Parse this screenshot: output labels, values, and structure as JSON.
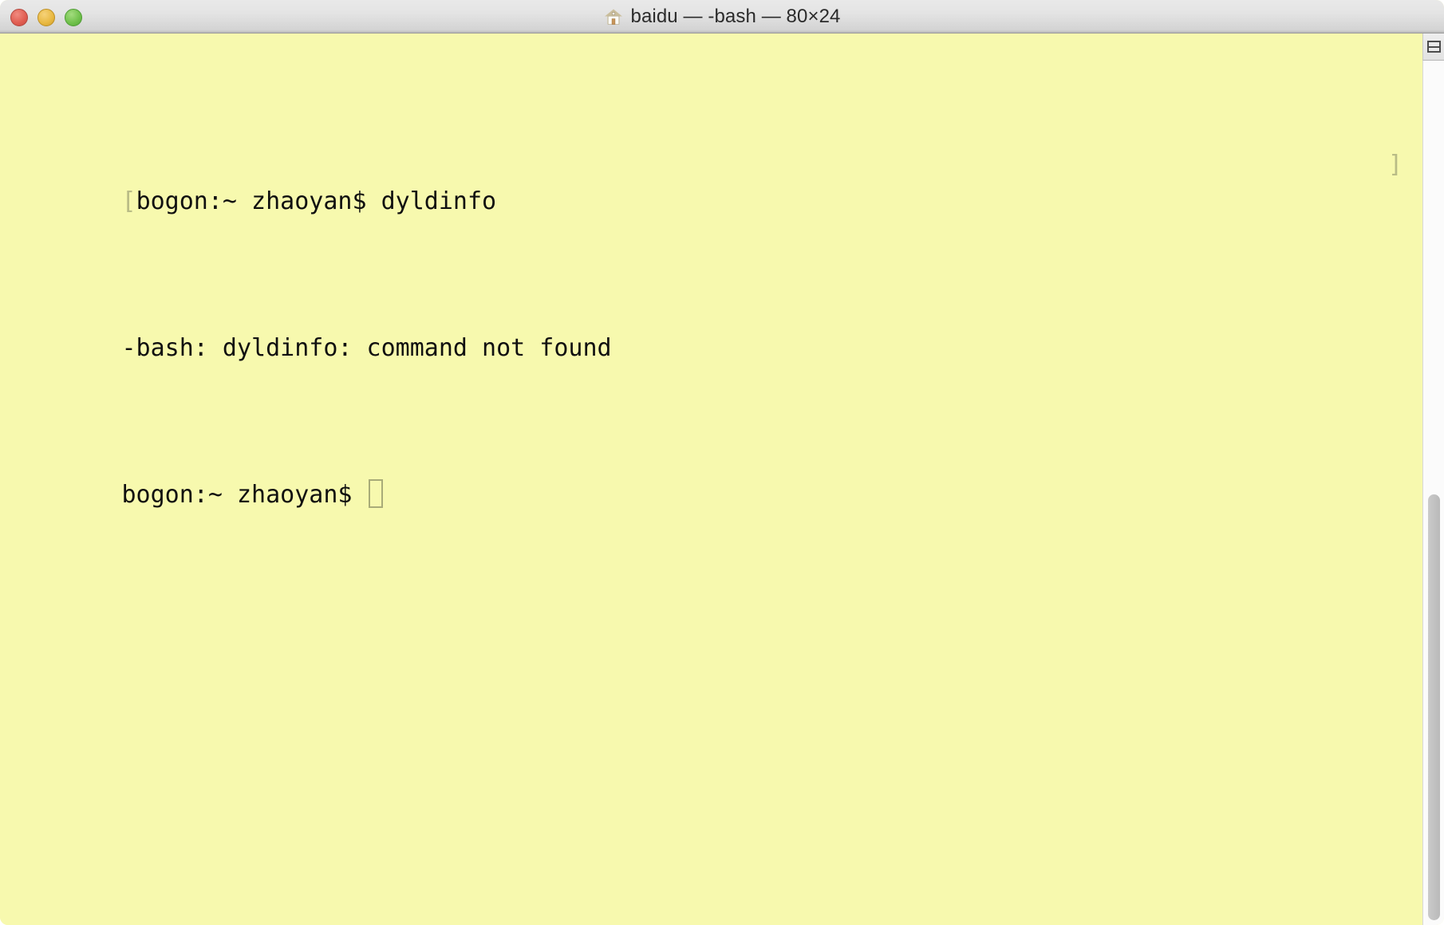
{
  "window": {
    "title": "baidu — -bash — 80×24",
    "title_icon": "home-icon",
    "traffic_lights": [
      {
        "name": "close",
        "label": "Close",
        "color": "#e05c50"
      },
      {
        "name": "minimize",
        "label": "Minimize",
        "color": "#e8b840"
      },
      {
        "name": "zoom",
        "label": "Zoom",
        "color": "#6fc04a"
      }
    ]
  },
  "theme": {
    "background": "#f7f9ae",
    "foreground": "#101010",
    "dim": "#b9bc86",
    "cursor_border": "#a8ab78",
    "titlebar_top": "#e9e9e9",
    "titlebar_bottom": "#b9b9b9"
  },
  "terminal": {
    "columns": 80,
    "rows": 24,
    "shell": "-bash",
    "session_name": "baidu",
    "left_marker": "[",
    "right_marker": "]",
    "lines": [
      {
        "text": "bogon:~ zhaoyan$ dyldinfo",
        "has_cursor": false
      },
      {
        "text": "-bash: dyldinfo: command not found",
        "has_cursor": false
      },
      {
        "text": "bogon:~ zhaoyan$ ",
        "has_cursor": true
      }
    ],
    "prompt": "bogon:~ zhaoyan$",
    "last_command": "dyldinfo",
    "error_output": "-bash: dyldinfo: command not found"
  },
  "scrollbar": {
    "split_button_label": "Split pane",
    "thumb_name": "scroll-thumb"
  }
}
